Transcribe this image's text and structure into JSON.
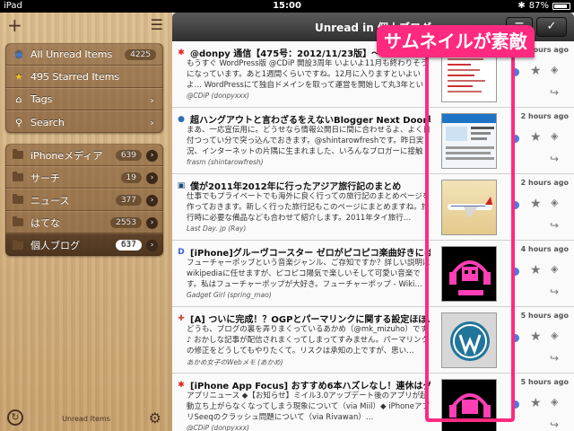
{
  "status": {
    "carrier": "iPad",
    "time": "15:00",
    "battery": "87%"
  },
  "sidebar": {
    "top_items": [
      {
        "label": "All Unread Items",
        "count": "4225",
        "icon": "rss-icon"
      },
      {
        "label": "495 Starred Items",
        "count": "",
        "icon": "star-icon"
      },
      {
        "label": "Tags",
        "count": "",
        "icon": "tag-icon"
      },
      {
        "label": "Search",
        "count": "",
        "icon": "search-icon"
      }
    ],
    "folders": [
      {
        "label": "iPhoneメディア",
        "count": "639"
      },
      {
        "label": "サーチ",
        "count": "19"
      },
      {
        "label": "ニュース",
        "count": "377"
      },
      {
        "label": "はてな",
        "count": "2553"
      },
      {
        "label": "個人ブログ",
        "count": "637"
      }
    ],
    "bottom_label": "Unread Items"
  },
  "navbar": {
    "title": "Unread in 個人ブログ"
  },
  "articles": [
    {
      "title": "@donpy 通信【475号：2012/11/23版】～ ちょっとまずいかも!?",
      "summary": "もうすぐ WordPress版 @CDiP 開設3周年 いよいよ11月も終わりそうになっています。あと1週間くらいですね。12月に入りますといよいよ… WordPressにて独自ドメインを取って運営を開始して丸3年という…",
      "author": "@CDiP (donpyxxx)",
      "time": "1 hours ago",
      "fav": "✱",
      "favcolor": "#e02020"
    },
    {
      "title": "超ハングアウトと言わざるをえないBlogger Next Door略…",
      "summary": "まあ、一応宣伝用に。どうせなら情報公開日に間に合わせるよ、よく日付つってい分で突っ込んでおきます。@shintarowfreshです。昨日実況、インターネットの片隅に生まれました、いろんなブロガーに接触を…",
      "author": "frasm (shintarowfresh)",
      "time": "2 hours ago",
      "fav": "●",
      "favcolor": "#2a6fb0"
    },
    {
      "title": "僕が2011年2012年に行ったアジア旅行記のまとめ",
      "summary": "仕事でもプライベートでも海外に良く行っての旅行記のまとめページを作っておきます。新しく行った旅行記もこのページにまとめますね。旅行時に必要な備品なども合わせて紹介します。2011年タイ旅行…",
      "author": "Last Day. jp (Ray)",
      "time": "2 hours ago",
      "fav": "▣",
      "favcolor": "#1c4d7a"
    },
    {
      "title": "[iPhone]グルーヴコースター ゼロがピコピコ楽曲好きには…",
      "summary": "フューチャーポップという音楽ジャンル、ご存知ですか？詳しい説明はwikipediaに任せますが、ピコピコ陽気で楽しいそして可愛い音楽です。私はフューチャーポップが大好き。フューチャーポップ - Wiki…",
      "author": "Gadget Girl (spring_mao)",
      "time": "4 hours ago",
      "fav": "D",
      "favcolor": "#3a5fcf"
    },
    {
      "title": "[A] ついに完成！？OGPとパーマリンクに関する設定ほぼ…",
      "summary": "どうも、ブログの裏を弄りまくっているあかめ（@mk_mizuho）です♪ おかしな記事が配信されまくってしまってすみません。パーマリンクの修正をどうしてもやりたくて。リスクは承知の上ですが、思い…",
      "author": "あかめ女子のWebメモ (あかめ)",
      "time": "5 hours ago",
      "fav": "✚",
      "favcolor": "#d0483a"
    },
    {
      "title": "[iPhone App Focus] おすすめ6本ハズレなし！連休はグル…",
      "summary": "アプリニュース ◆【お知らせ】ミイル3.0アップデート後のアプリが起動立ち上がらなくなってしまう現象について（via Miil）◆ iPhoneアプリSeeqのクラッシュ問題について（via Rivawan）…",
      "author": "@CDiP (donpyxxx)",
      "time": "5 hours ago",
      "fav": "✱",
      "favcolor": "#e02020"
    }
  ],
  "callout": {
    "text": "サムネイルが素敵"
  },
  "colors": {
    "accent": "#ff2a7f",
    "unread_dot": "#4a7be0"
  }
}
